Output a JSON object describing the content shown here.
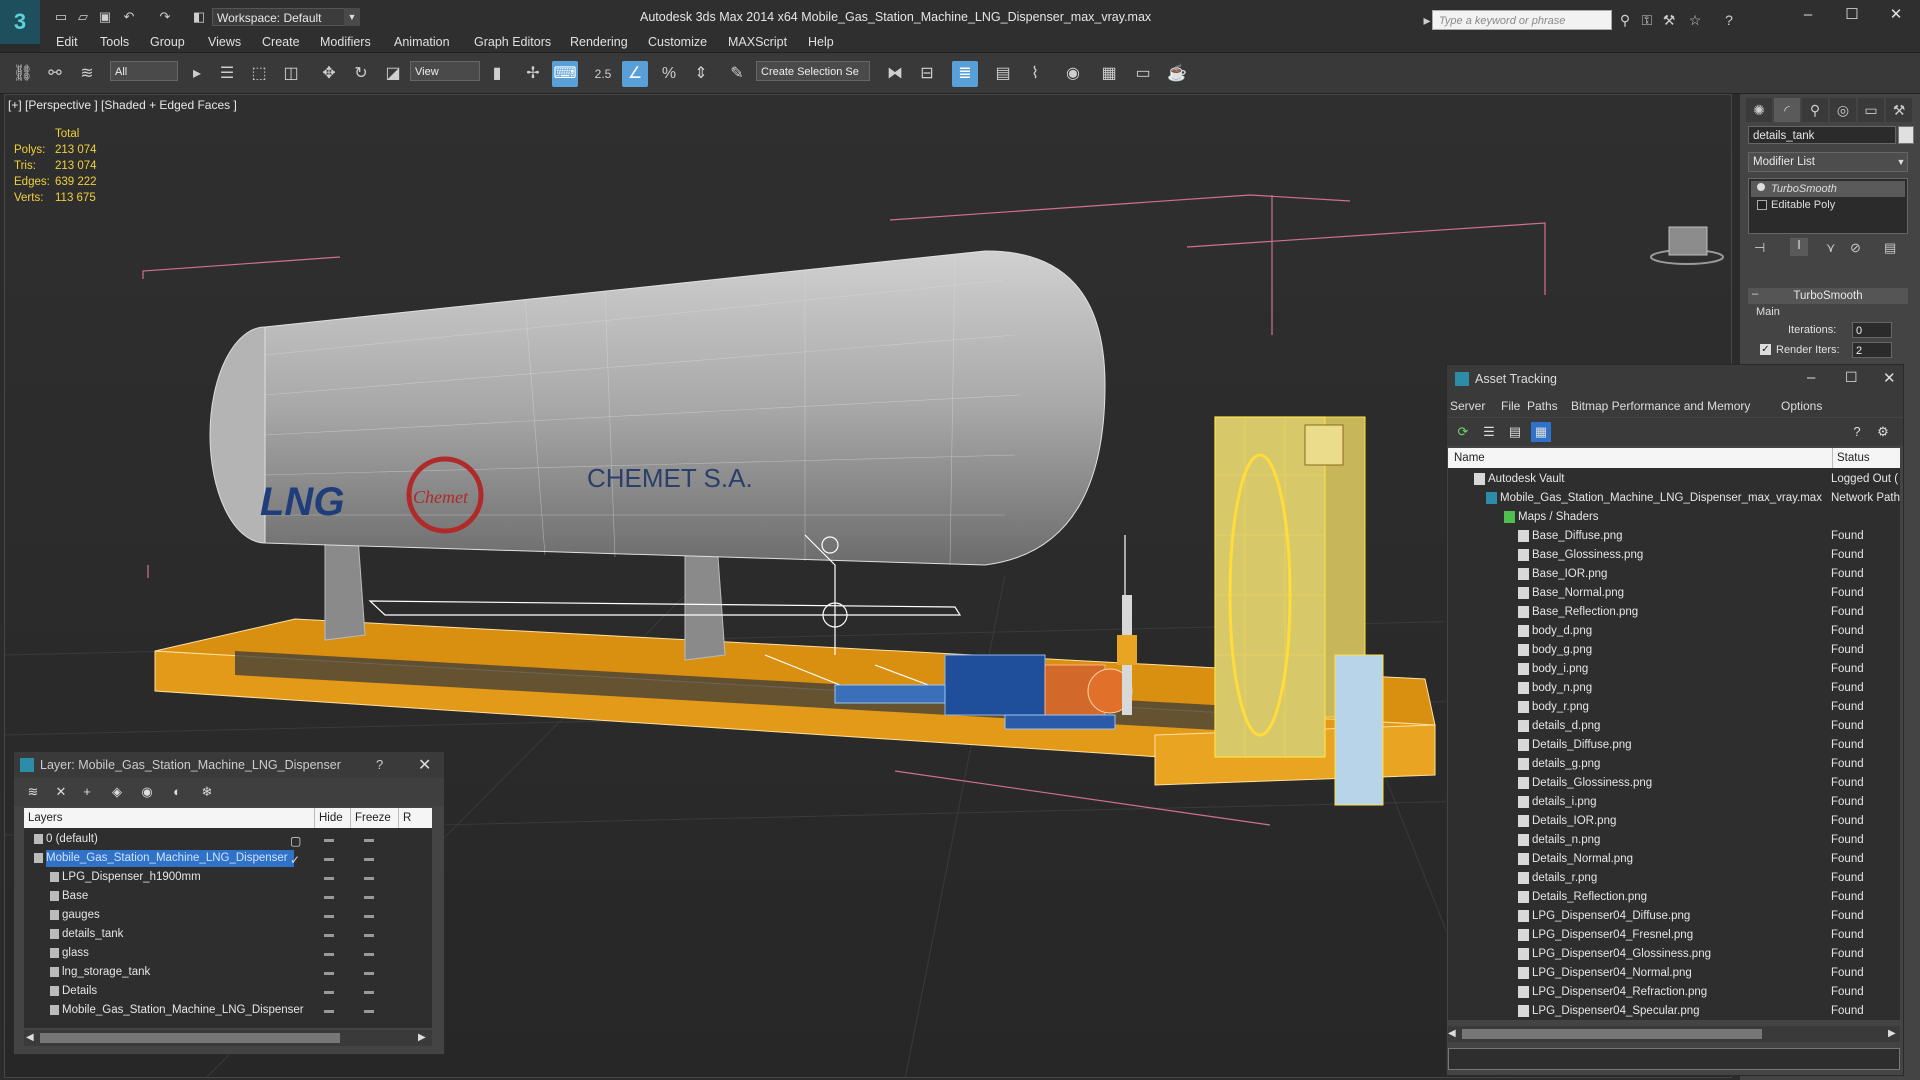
{
  "app": {
    "logo_letter": "3",
    "workspace": "Workspace: Default",
    "window_title": "Autodesk 3ds Max  2014 x64     Mobile_Gas_Station_Machine_LNG_Dispenser_max_vray.max",
    "search_placeholder": "Type a keyword or phrase"
  },
  "menu": [
    "Edit",
    "Tools",
    "Group",
    "Views",
    "Create",
    "Modifiers",
    "Animation",
    "Graph Editors",
    "Rendering",
    "Customize",
    "MAXScript",
    "Help"
  ],
  "toolbar": {
    "selection_filter": "All",
    "ref_coord": "View",
    "snap_value": "2.5",
    "named_selection": "Create Selection Se"
  },
  "viewport": {
    "label": "[+] [Perspective ] [Shaded + Edged Faces ]",
    "stats_title": "Total",
    "stats": [
      {
        "label": "Polys:",
        "value": "213 074"
      },
      {
        "label": "Tris:",
        "value": "213 074"
      },
      {
        "label": "Edges:",
        "value": "639 222"
      },
      {
        "label": "Verts:",
        "value": "113 675"
      }
    ],
    "tank_text_1": "LNG",
    "tank_text_2": "CHEMET S.A.",
    "tank_logo": "Chemet"
  },
  "command_panel": {
    "object_name": "details_tank",
    "modifier_list": "Modifier List",
    "stack": [
      "TurboSmooth",
      "Editable Poly"
    ],
    "rollout": "TurboSmooth",
    "group": "Main",
    "iterations_label": "Iterations:",
    "iterations": "0",
    "render_iters_label": "Render Iters:",
    "render_iters": "2"
  },
  "asset_tracking": {
    "title": "Asset Tracking",
    "menu": [
      "Server",
      "File",
      "Paths",
      "Bitmap Performance and Memory",
      "Options"
    ],
    "col_name": "Name",
    "col_status": "Status",
    "rows": [
      {
        "name": "Autodesk Vault",
        "status": "Logged Out ("
      },
      {
        "name": "Mobile_Gas_Station_Machine_LNG_Dispenser_max_vray.max",
        "status": "Network Path"
      },
      {
        "name": "Maps / Shaders",
        "status": ""
      },
      {
        "name": "Base_Diffuse.png",
        "status": "Found"
      },
      {
        "name": "Base_Glossiness.png",
        "status": "Found"
      },
      {
        "name": "Base_IOR.png",
        "status": "Found"
      },
      {
        "name": "Base_Normal.png",
        "status": "Found"
      },
      {
        "name": "Base_Reflection.png",
        "status": "Found"
      },
      {
        "name": "body_d.png",
        "status": "Found"
      },
      {
        "name": "body_g.png",
        "status": "Found"
      },
      {
        "name": "body_i.png",
        "status": "Found"
      },
      {
        "name": "body_n.png",
        "status": "Found"
      },
      {
        "name": "body_r.png",
        "status": "Found"
      },
      {
        "name": "details_d.png",
        "status": "Found"
      },
      {
        "name": "Details_Diffuse.png",
        "status": "Found"
      },
      {
        "name": "details_g.png",
        "status": "Found"
      },
      {
        "name": "Details_Glossiness.png",
        "status": "Found"
      },
      {
        "name": "details_i.png",
        "status": "Found"
      },
      {
        "name": "Details_IOR.png",
        "status": "Found"
      },
      {
        "name": "details_n.png",
        "status": "Found"
      },
      {
        "name": "Details_Normal.png",
        "status": "Found"
      },
      {
        "name": "details_r.png",
        "status": "Found"
      },
      {
        "name": "Details_Reflection.png",
        "status": "Found"
      },
      {
        "name": "LPG_Dispenser04_Diffuse.png",
        "status": "Found"
      },
      {
        "name": "LPG_Dispenser04_Fresnel.png",
        "status": "Found"
      },
      {
        "name": "LPG_Dispenser04_Glossiness.png",
        "status": "Found"
      },
      {
        "name": "LPG_Dispenser04_Normal.png",
        "status": "Found"
      },
      {
        "name": "LPG_Dispenser04_Refraction.png",
        "status": "Found"
      },
      {
        "name": "LPG_Dispenser04_Specular.png",
        "status": "Found"
      }
    ]
  },
  "layer_dialog": {
    "title": "Layer: Mobile_Gas_Station_Machine_LNG_Dispenser",
    "help": "?",
    "col_layers": "Layers",
    "col_hide": "Hide",
    "col_freeze": "Freeze",
    "col_r": "R",
    "rows": [
      {
        "name": "0 (default)"
      },
      {
        "name": "Mobile_Gas_Station_Machine_LNG_Dispenser"
      },
      {
        "name": "LPG_Dispenser_h1900mm"
      },
      {
        "name": "Base"
      },
      {
        "name": "gauges"
      },
      {
        "name": "details_tank"
      },
      {
        "name": "glass"
      },
      {
        "name": "lng_storage_tank"
      },
      {
        "name": "Details"
      },
      {
        "name": "Mobile_Gas_Station_Machine_LNG_Dispenser"
      }
    ]
  }
}
